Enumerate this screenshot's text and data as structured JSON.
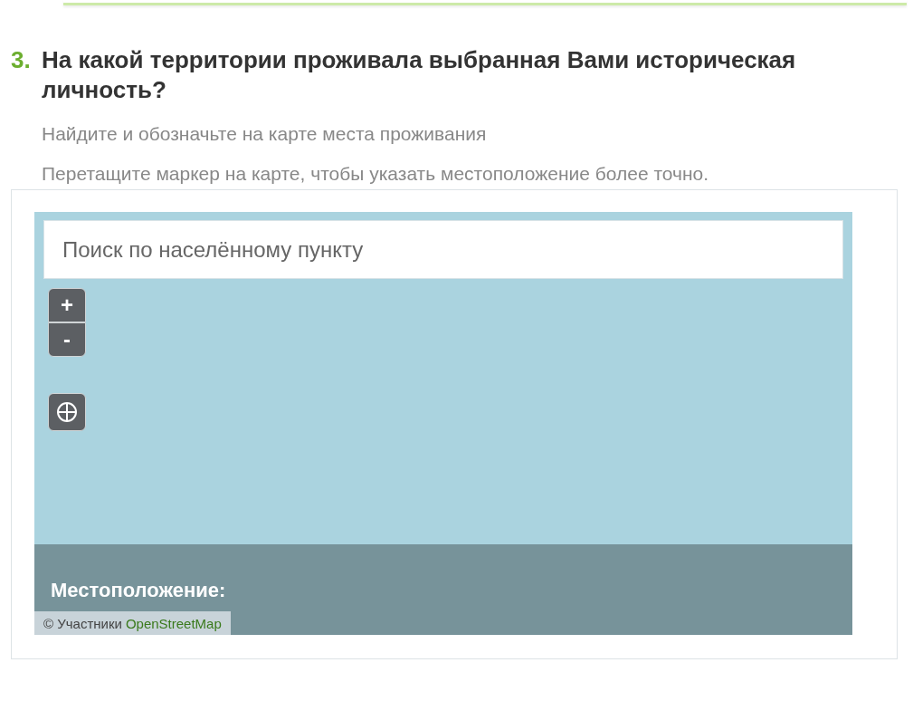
{
  "question": {
    "number": "3.",
    "title": "На какой территории проживала выбранная Вами историческая личность?",
    "hints": [
      "Найдите и обозначьте на карте места проживания",
      "Перетащите маркер на карте, чтобы указать местоположение более точно."
    ]
  },
  "map": {
    "search": {
      "placeholder": "Поиск по населённому пункту"
    },
    "zoom_in": "+",
    "zoom_out": "-",
    "location_label": "Местоположение:",
    "attribution": {
      "prefix": "© Участники",
      "link": "OpenStreetMap"
    }
  }
}
